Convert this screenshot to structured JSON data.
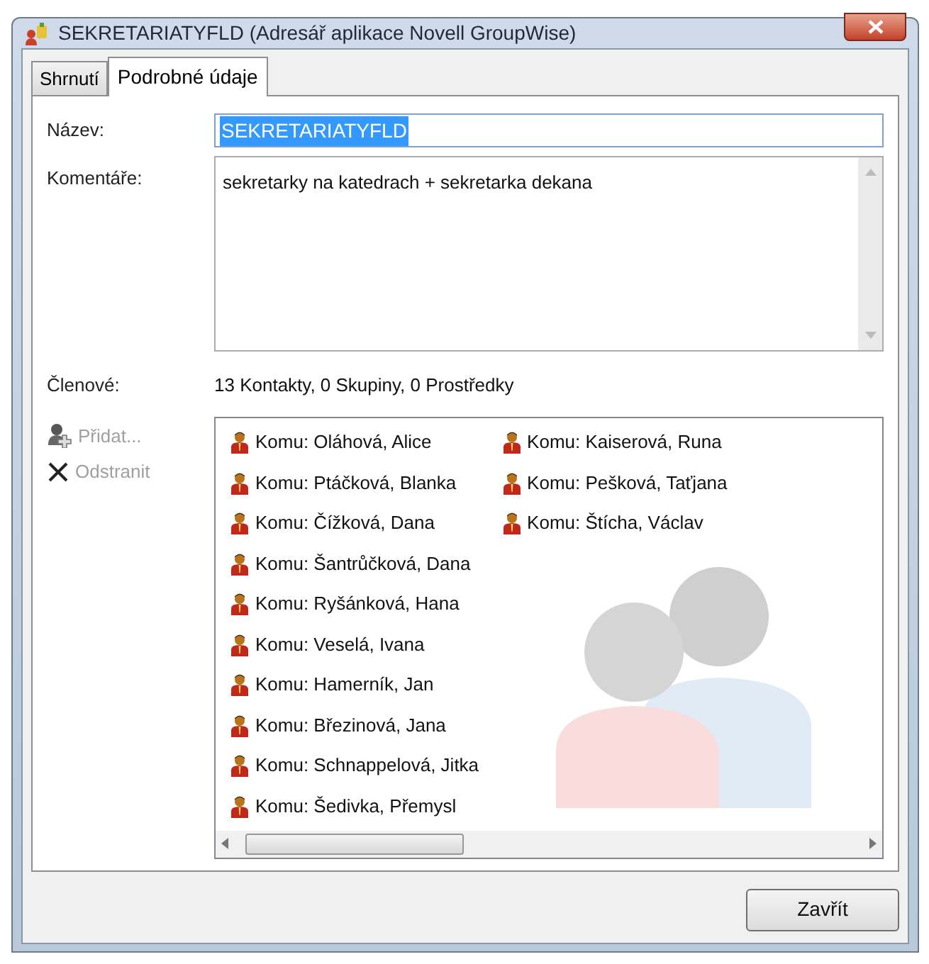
{
  "window": {
    "title": "SEKRETARIATYFLD (Adresář aplikace Novell GroupWise)"
  },
  "tabs": [
    {
      "label": "Shrnutí",
      "selected": false
    },
    {
      "label": "Podrobné údaje",
      "selected": true
    }
  ],
  "name": {
    "label": "Název:",
    "value": "SEKRETARIATYFLD"
  },
  "comments": {
    "label": "Komentáře:",
    "value": "sekretarky na katedrach + sekretarka dekana"
  },
  "members": {
    "label": "Členové:",
    "summary": "13 Kontakty, 0 Skupiny, 0 Prostředky"
  },
  "actions": [
    {
      "kind": "add",
      "label": "Přidat...",
      "disabled": true
    },
    {
      "kind": "remove",
      "label": "Odstranit",
      "disabled": true
    }
  ],
  "member_list": [
    {
      "label": "Komu: Oláhová, Alice"
    },
    {
      "label": "Komu: Ptáčková, Blanka"
    },
    {
      "label": "Komu: Čížková, Dana"
    },
    {
      "label": "Komu: Šantrůčková, Dana"
    },
    {
      "label": "Komu: Ryšánková, Hana"
    },
    {
      "label": "Komu: Veselá, Ivana"
    },
    {
      "label": "Komu: Hamerník, Jan"
    },
    {
      "label": "Komu: Březinová, Jana"
    },
    {
      "label": "Komu: Schnappelová, Jitka"
    },
    {
      "label": "Komu: Šedivka, Přemysl"
    },
    {
      "label": "Komu: Kaiserová, Runa"
    },
    {
      "label": "Komu: Pešková, Taťjana"
    },
    {
      "label": "Komu: Štícha, Václav"
    }
  ],
  "buttons": [
    {
      "label": "Zavřít"
    }
  ]
}
